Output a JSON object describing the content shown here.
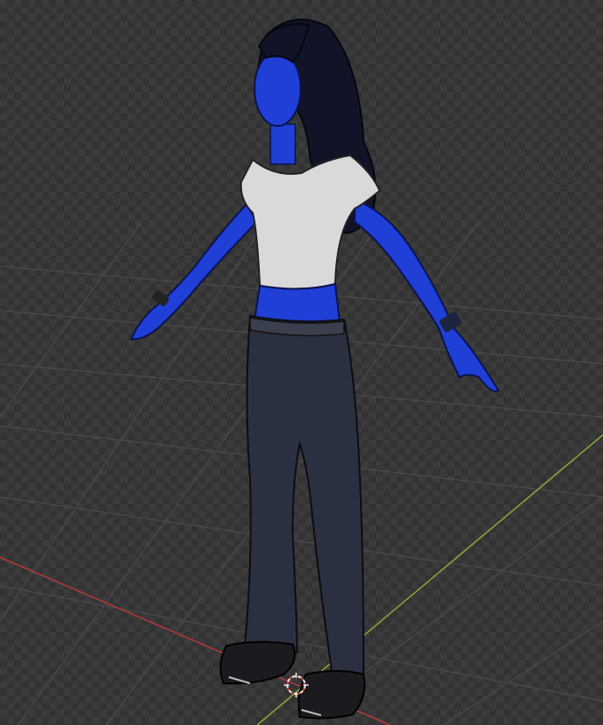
{
  "viewport": {
    "mode": "",
    "background_color": "#3b3b3b",
    "grid_color": "#4a4a4a",
    "x_axis_color": "#b23a3a",
    "y_axis_color": "#8aa83a"
  },
  "scene": {
    "object": "character-model",
    "skin_color": "#1f3fd6",
    "hair_color": "#101426",
    "shirt_color": "#d9d9d9",
    "jeans_color": "#2b3040",
    "shoe_color": "#1b1b1f",
    "cursor": "3d-cursor-icon"
  }
}
